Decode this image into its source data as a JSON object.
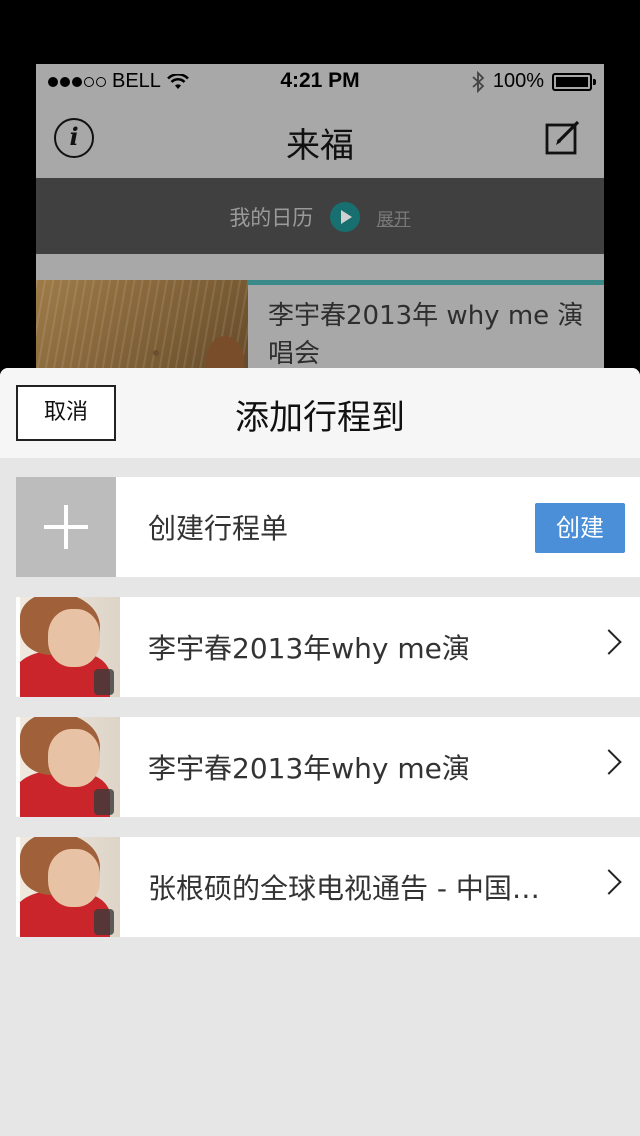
{
  "status_bar": {
    "carrier": "BELL",
    "time": "4:21 PM",
    "battery": "100%",
    "signal_strength": 3,
    "signal_max": 5
  },
  "background_app": {
    "title": "来福",
    "info_icon": "info-icon",
    "edit_icon": "compose-icon",
    "calendar": {
      "label": "我的日历",
      "expand": "展开"
    },
    "card": {
      "title": "李宇春2013年 why me 演唱会"
    }
  },
  "sheet": {
    "title": "添加行程到",
    "cancel_label": "取消",
    "create_row": {
      "label": "创建行程单",
      "button": "创建"
    },
    "items": [
      {
        "label": "李宇春2013年why me演"
      },
      {
        "label": "李宇春2013年why me演"
      },
      {
        "label": "张根硕的全球电视通告 - 中国…"
      }
    ]
  },
  "colors": {
    "accent_blue": "#4a8fd8",
    "calendar_bar": "#404040",
    "teal": "#176f6f"
  }
}
